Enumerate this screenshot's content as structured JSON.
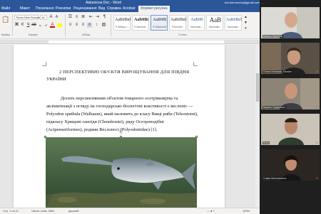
{
  "title_bar": {
    "doc_title": "Авіаносна Doc - Word",
    "user": "kornherrmanna@gmail.com"
  },
  "ribbon_tabs": [
    "Файл",
    "Макет",
    "Посилання",
    "Розсилки",
    "Рецензування",
    "Вид",
    "Справка",
    "Acrobat",
    "Формат рисунка"
  ],
  "ribbon": {
    "font_name": "Times New Roman",
    "font_size": "14",
    "group_font": "Шрифт",
    "group_paragraph": "Абзац",
    "group_styles": "Стили",
    "group_clipboard": "Буфер",
    "styles": [
      {
        "sample": "АаБбВвГ",
        "name": "¶ Абзац с..."
      },
      {
        "sample": "АаБбВі",
        "name": "¶ Заголов..."
      },
      {
        "sample": "АаБбВі",
        "name": "¶ Обычный"
      },
      {
        "sample": "АаБбВвГ",
        "name": "¶ Без инт..."
      },
      {
        "sample": "АаБбВ",
        "name": "Заголово..."
      },
      {
        "sample": "АаВ",
        "name": "Заголово..."
      },
      {
        "sample": "АаБбВеГ",
        "name": "Заголово..."
      }
    ]
  },
  "document": {
    "heading_line1": "2 ПЕРСПЕКТИВНІ ОБ'ЄКТИ ВИРОЩУВАННЯ ДЛЯ ПІВДНЯ",
    "heading_line2": "УКРАЇНИ",
    "paragraph_lines": [
      "Досить перспективним об'єктом товарного осетрівництва та",
      "акліматизації з огляду на господарсько-біологічні властивості є веслоніс —",
      "Polyodon spathula (Walbaum), який належить до класу Вищі риби (Teleostomi),",
      "підкласу Хрящові ганоїди (Chondrostei), ряду Осетроподібні",
      "(Acipenseriformes), родини Веслоносі (Polyodontidae) [1]."
    ]
  },
  "status_bar": {
    "page": "Стр. 1 из 11",
    "words": "Число слов: 2561",
    "language": "русский",
    "zoom": "100%"
  },
  "participants": [
    {
      "name": "Кирило Кирилов",
      "muted": false
    },
    {
      "name": "Олена Нонікова, Ukraine",
      "muted": true
    },
    {
      "name": "Кирило Сидоренко",
      "muted": true
    },
    {
      "name": "Вова",
      "muted": true
    },
    {
      "name": "Софія Мельниченко",
      "muted": true
    }
  ],
  "colors": {
    "word_blue": "#2b579a",
    "video_bg": "#1f1f1f",
    "squiggle": "#d00000"
  }
}
